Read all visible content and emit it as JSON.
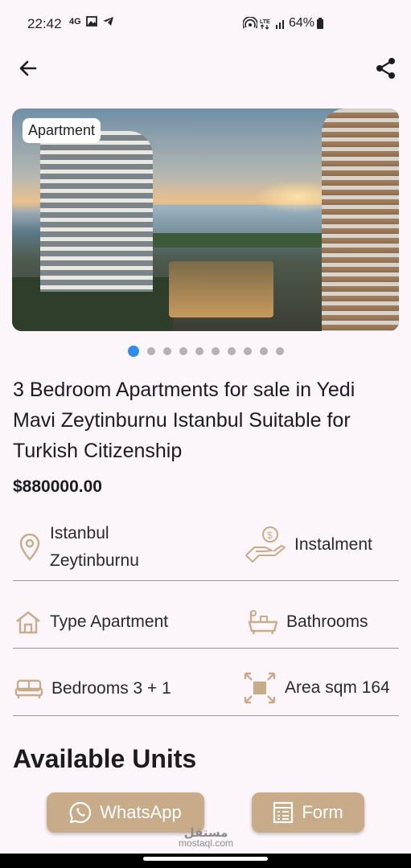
{
  "status": {
    "time": "22:42",
    "network": "4G",
    "battery": "64%"
  },
  "listing": {
    "badge": "Apartment",
    "title": "3 Bedroom Apartments for sale in Yedi Mavi Zeytinburnu Istanbul Suitable for Turkish Citizenship",
    "price": "$880000.00",
    "image_count": 10,
    "active_image": 1
  },
  "details": {
    "location_line1": "Istanbul",
    "location_line2": "Zeytinburnu",
    "payment": "Instalment",
    "type": "Type Apartment",
    "bathrooms": "Bathrooms",
    "bedrooms": "Bedrooms 3 + 1",
    "area": "Area sqm 164"
  },
  "sections": {
    "units_title": "Available Units"
  },
  "actions": {
    "whatsapp_label": "WhatsApp",
    "form_label": "Form"
  },
  "watermark": {
    "line1": "مستقل",
    "line2": "mostaql.com"
  },
  "colors": {
    "accent": "#c8ac8a",
    "active_dot": "#2d8ef0",
    "background": "#fcf6fb"
  }
}
